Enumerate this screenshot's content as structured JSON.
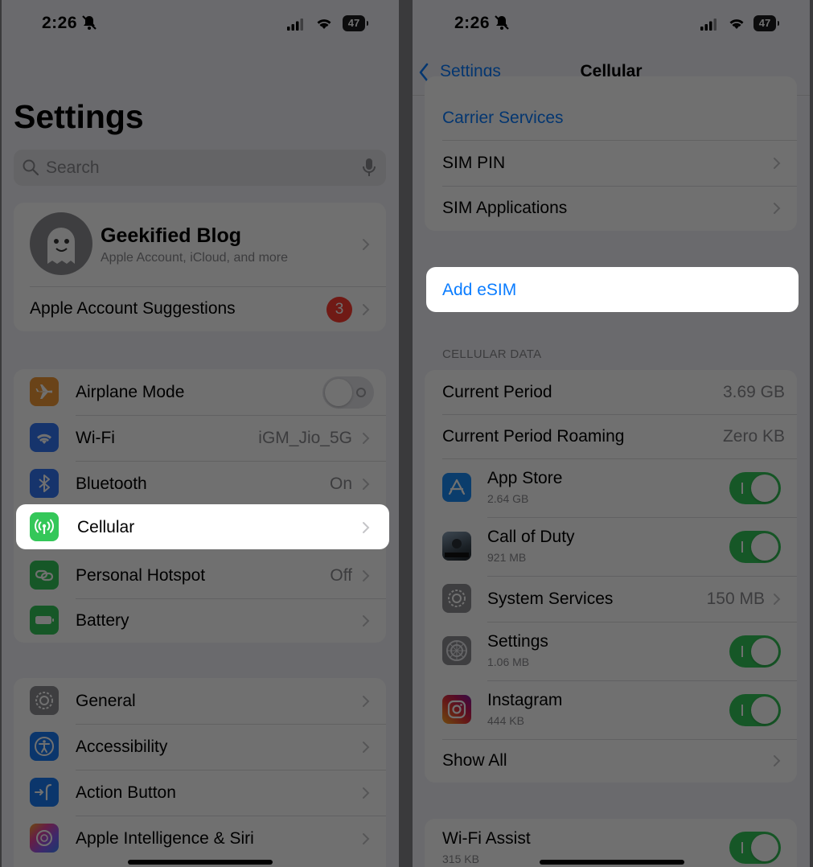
{
  "left": {
    "status": {
      "time": "2:26",
      "battery": "47"
    },
    "title": "Settings",
    "search": {
      "placeholder": "Search"
    },
    "account": {
      "name": "Geekified Blog",
      "subtitle": "Apple Account, iCloud, and more",
      "suggestions_label": "Apple Account Suggestions",
      "suggestions_badge": "3"
    },
    "connectivity": [
      {
        "label": "Airplane Mode",
        "value": "",
        "icon": "airplane-icon",
        "color": "#f19a37",
        "toggle": false
      },
      {
        "label": "Wi-Fi",
        "value": "iGM_Jio_5G",
        "icon": "wifi-icon",
        "color": "#3478f6"
      },
      {
        "label": "Bluetooth",
        "value": "On",
        "icon": "bluetooth-icon",
        "color": "#3478f6"
      },
      {
        "label": "Cellular",
        "value": "",
        "icon": "cellular-antenna-icon",
        "color": "#34c759"
      },
      {
        "label": "Personal Hotspot",
        "value": "Off",
        "icon": "hotspot-link-icon",
        "color": "#34c759"
      },
      {
        "label": "Battery",
        "value": "",
        "icon": "battery-icon",
        "color": "#34c759"
      }
    ],
    "general": [
      {
        "label": "General",
        "icon": "gear-icon",
        "color": "#8e8e93"
      },
      {
        "label": "Accessibility",
        "icon": "accessibility-icon",
        "color": "#1a7cf5"
      },
      {
        "label": "Action Button",
        "icon": "action-button-icon",
        "color": "#1a7cf5"
      },
      {
        "label": "Apple Intelligence & Siri",
        "icon": "apple-intelligence-icon",
        "color": "#b866d9"
      }
    ],
    "highlighted": "Cellular"
  },
  "right": {
    "status": {
      "time": "2:26",
      "battery": "47"
    },
    "nav": {
      "back_label": "Settings",
      "title": "Cellular"
    },
    "sim_group": [
      {
        "label": "Carrier Services",
        "style": "link"
      },
      {
        "label": "SIM PIN"
      },
      {
        "label": "SIM Applications"
      }
    ],
    "add_esim": "Add eSIM",
    "cellular_data_header": "CELLULAR DATA",
    "usage_rows": [
      {
        "label": "Current Period",
        "value": "3.69 GB"
      },
      {
        "label": "Current Period Roaming",
        "value": "Zero KB"
      }
    ],
    "apps": [
      {
        "label": "App Store",
        "sub": "2.64 GB",
        "icon": "app-store-icon",
        "toggle": true
      },
      {
        "label": "Call of Duty",
        "sub": "921 MB",
        "icon": "call-of-duty-icon",
        "toggle": true
      },
      {
        "label": "System Services",
        "value": "150 MB",
        "icon": "gear-icon"
      },
      {
        "label": "Settings",
        "sub": "1.06 MB",
        "icon": "settings-gear-icon",
        "toggle": true
      },
      {
        "label": "Instagram",
        "sub": "444 KB",
        "icon": "instagram-icon",
        "toggle": true
      }
    ],
    "show_all": "Show All",
    "wifi_assist": {
      "label": "Wi-Fi Assist",
      "sub": "315 KB",
      "toggle": true
    },
    "highlighted": "Add eSIM"
  }
}
